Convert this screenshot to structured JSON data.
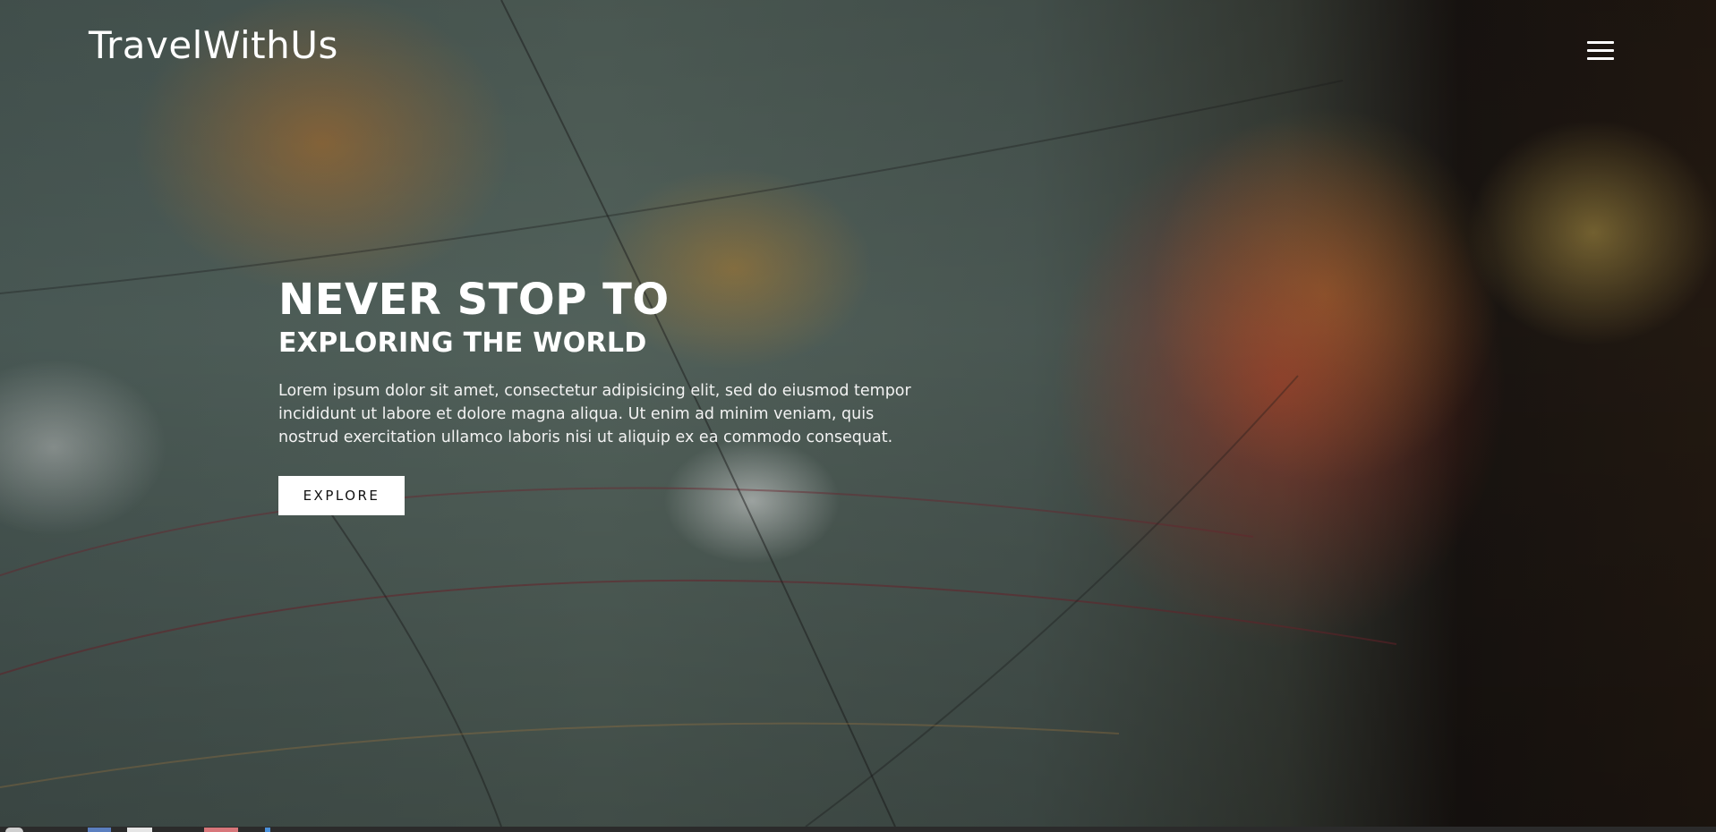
{
  "header": {
    "brand": "TravelWithUs",
    "menu_icon": "hamburger-menu-icon"
  },
  "hero": {
    "title_line_1": "NEVER STOP TO",
    "title_line_2": "EXPLORING THE WORLD",
    "description": "Lorem ipsum dolor sit amet, consectetur adipisicing elit, sed do eiusmod tempor incididunt ut labore et dolore magna aliqua. Ut enim ad minim veniam, quis nostrud exercitation ullamco laboris nisi ut aliquip ex ea commodo consequat.",
    "cta_label": "EXPLORE",
    "background_image": "blurred-globe-map"
  },
  "colors": {
    "text": "#ffffff",
    "button_bg": "#ffffff",
    "button_text": "#111111",
    "taskbar": "#2b2b2b"
  }
}
